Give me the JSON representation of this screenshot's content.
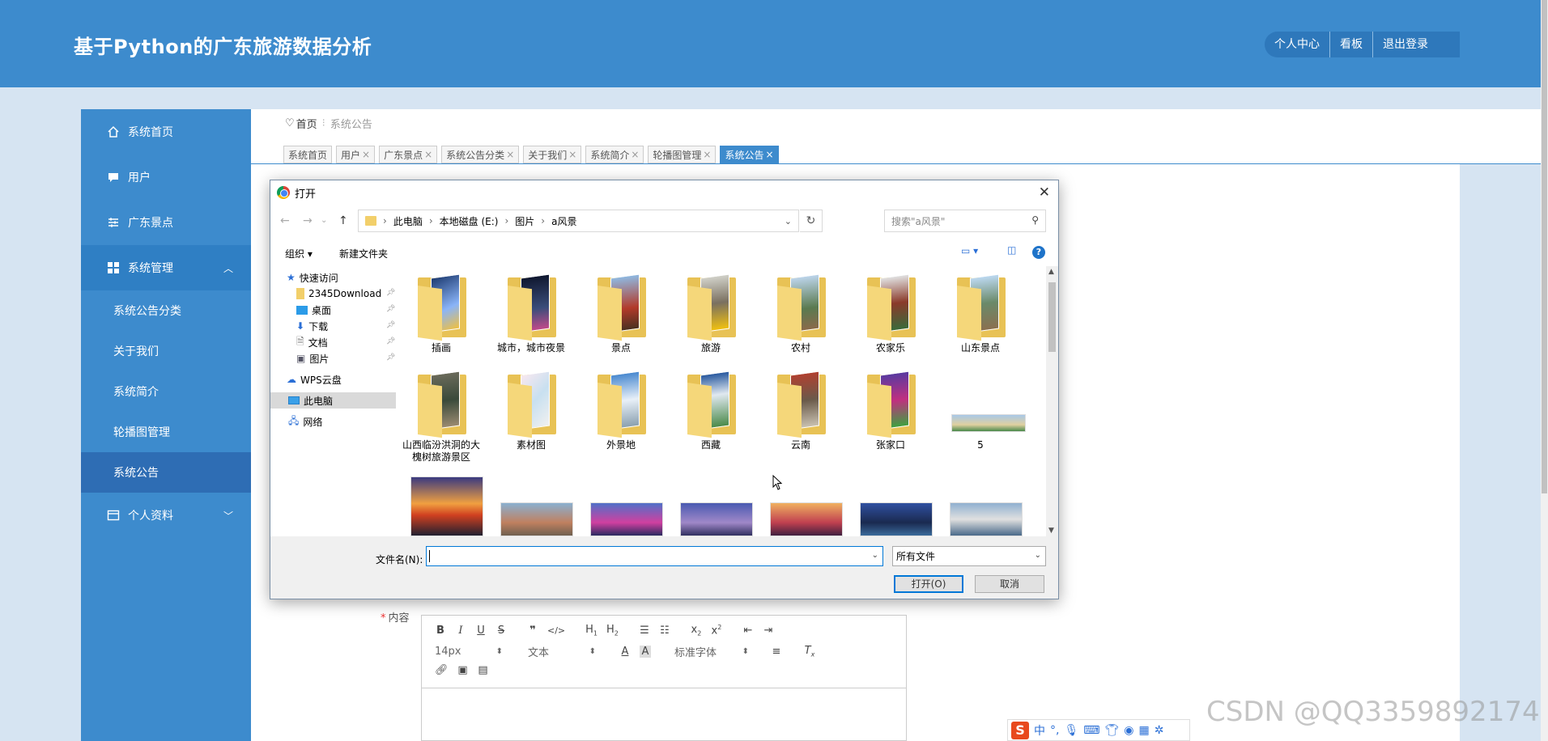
{
  "app": {
    "title": "基于Python的广东旅游数据分析",
    "top_links": [
      "个人中心",
      "看板",
      "退出登录"
    ]
  },
  "sidebar": {
    "items": [
      {
        "label": "系统首页",
        "icon": "home-icon"
      },
      {
        "label": "用户",
        "icon": "chat-icon"
      },
      {
        "label": "广东景点",
        "icon": "sliders-icon"
      },
      {
        "label": "系统管理",
        "icon": "grid-icon",
        "expanded": true
      },
      {
        "label": "个人资料",
        "icon": "card-icon"
      }
    ],
    "sub_items": [
      "系统公告分类",
      "关于我们",
      "系统简介",
      "轮播图管理",
      "系统公告"
    ],
    "active_sub": "系统公告"
  },
  "breadcrumb": {
    "home": "首页",
    "current": "系统公告"
  },
  "tabs": [
    {
      "label": "系统首页",
      "closable": false
    },
    {
      "label": "用户",
      "closable": true
    },
    {
      "label": "广东景点",
      "closable": true
    },
    {
      "label": "系统公告分类",
      "closable": true
    },
    {
      "label": "关于我们",
      "closable": true
    },
    {
      "label": "系统简介",
      "closable": true
    },
    {
      "label": "轮播图管理",
      "closable": true
    },
    {
      "label": "系统公告",
      "closable": true,
      "active": true
    }
  ],
  "form": {
    "content_label": "内容",
    "editor": {
      "font_size": "14px",
      "block_type": "文本",
      "font_family": "标准字体"
    }
  },
  "dialog": {
    "title": "打开",
    "path": [
      "此电脑",
      "本地磁盘 (E:)",
      "图片",
      "a风景"
    ],
    "search_placeholder": "搜索\"a风景\"",
    "organize": "组织",
    "new_folder": "新建文件夹",
    "nav": {
      "quick_access": "快速访问",
      "quick_items": [
        "2345Download",
        "桌面",
        "下载",
        "文档",
        "图片"
      ],
      "wps": "WPS云盘",
      "this_pc": "此电脑",
      "network": "网络"
    },
    "folders": [
      "插画",
      "城市，城市夜景",
      "景点",
      "旅游",
      "农村",
      "农家乐",
      "山东景点",
      "山西临汾洪洞的大槐树旅游景区",
      "素材图",
      "外景地",
      "西藏",
      "云南",
      "张家口"
    ],
    "image_files": [
      "5"
    ],
    "filename_label": "文件名(N):",
    "filename_value": "",
    "filetype": "所有文件",
    "open_button": "打开(O)",
    "cancel_button": "取消"
  },
  "watermark": "CSDN @QQ3359892174",
  "ime": {
    "lang": "中"
  }
}
